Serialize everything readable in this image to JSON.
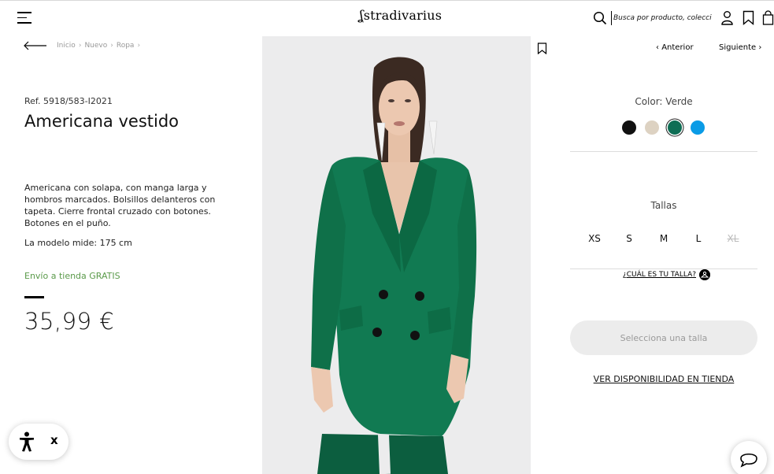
{
  "header": {
    "brand": "stradivarius",
    "search_placeholder": "Busca por producto, colección..."
  },
  "breadcrumb": [
    "Inicio",
    "Nuevo",
    "Ropa"
  ],
  "product": {
    "ref": "Ref. 5918/583-I2021",
    "title": "Americana vestido",
    "description": "Americana con solapa, con manga larga y hombros marcados. Bolsillos delanteros con tapeta. Cierre frontal cruzado con botones. Botones en el puño.",
    "model_height": "La modelo mide: 175 cm",
    "shipping": "Envío a tienda GRATIS",
    "price": "35,99 €"
  },
  "nav": {
    "prev": "Anterior",
    "next": "Siguiente"
  },
  "colors": {
    "label": "Color: Verde",
    "swatches": [
      {
        "name": "black",
        "hex": "#111111"
      },
      {
        "name": "beige",
        "hex": "#ddd2c2"
      },
      {
        "name": "green",
        "hex": "#0f6e55",
        "selected": true
      },
      {
        "name": "blue",
        "hex": "#0a9be6"
      }
    ]
  },
  "sizes": {
    "label": "Tallas",
    "options": [
      {
        "label": "XS",
        "available": true
      },
      {
        "label": "S",
        "available": true
      },
      {
        "label": "M",
        "available": true
      },
      {
        "label": "L",
        "available": true
      },
      {
        "label": "XL",
        "available": false
      }
    ],
    "guide": "¿CUÁL ES TU TALLA?"
  },
  "actions": {
    "add_button": "Selecciona una talla",
    "store_link": "VER DISPONIBILIDAD EN TIENDA"
  },
  "accessibility": {
    "close": "x"
  },
  "theme": {
    "accent_green": "#5a9a4a",
    "jacket_green": "#117a52"
  }
}
